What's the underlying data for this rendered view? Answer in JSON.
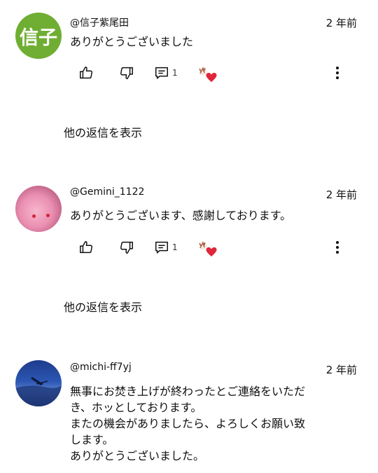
{
  "comments": [
    {
      "avatar_text": "信子",
      "author": "@信子紫尾田",
      "time": "2 年前",
      "text": "ありがとうございました",
      "reply_count": "1",
      "show_replies": "他の返信を表示"
    },
    {
      "author": "@Gemini_1122",
      "time": "2 年前",
      "text": "ありがとうございます、感謝しております。",
      "reply_count": "1",
      "show_replies": "他の返信を表示"
    },
    {
      "author": "@michi-ff7yj",
      "time": "2 年前",
      "text_lines": [
        "無事にお焚き上げが終わったとご連絡をいただ",
        "き、ホッとしております。",
        "またの機会がありましたら、よろしくお願い致",
        "します。",
        "ありがとうございました。"
      ]
    }
  ],
  "colors": {
    "avatar_green": "#6fae33",
    "heart_red": "#e0263b",
    "text": "#0f0f0f"
  },
  "icons": [
    "like-icon",
    "dislike-icon",
    "reply-icon",
    "creator-heart-icon",
    "more-vert-icon"
  ]
}
